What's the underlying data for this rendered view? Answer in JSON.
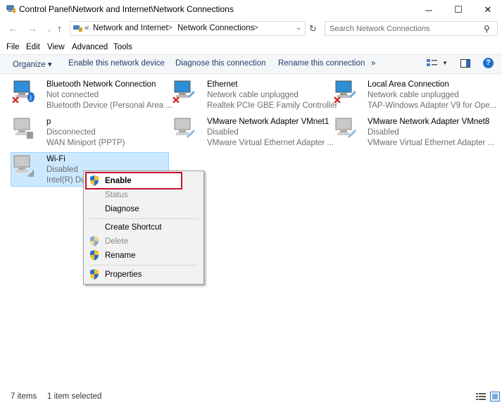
{
  "window": {
    "title": "Control Panel\\Network and Internet\\Network Connections"
  },
  "nav": {
    "breadcrumb_prefix": "«",
    "breadcrumb": [
      "Network and Internet",
      "Network Connections"
    ],
    "separator": ">",
    "search_placeholder": "Search Network Connections"
  },
  "menubar": [
    "File",
    "Edit",
    "View",
    "Advanced",
    "Tools"
  ],
  "commandbar": {
    "organize": "Organize ▾",
    "enable": "Enable this network device",
    "diagnose": "Diagnose this connection",
    "rename": "Rename this connection",
    "more": "»",
    "help": "?"
  },
  "items": [
    {
      "name": "Bluetooth Network Connection",
      "status": "Not connected",
      "device": "Bluetooth Device (Personal Area ...",
      "icon": "bluetooth-network-icon"
    },
    {
      "name": "Ethernet",
      "status": "Network cable unplugged",
      "device": "Realtek PCIe GBE Family Controller",
      "icon": "ethernet-icon"
    },
    {
      "name": "Local Area Connection",
      "status": "Network cable unplugged",
      "device": "TAP-Windows Adapter V9 for Ope...",
      "icon": "lan-icon"
    },
    {
      "name": "p",
      "status": "Disconnected",
      "device": "WAN Miniport (PPTP)",
      "icon": "vpn-icon"
    },
    {
      "name": "VMware Network Adapter VMnet1",
      "status": "Disabled",
      "device": "VMware Virtual Ethernet Adapter ...",
      "icon": "vmware-adapter-icon"
    },
    {
      "name": "VMware Network Adapter VMnet8",
      "status": "Disabled",
      "device": "VMware Virtual Ethernet Adapter ...",
      "icon": "vmware-adapter-icon"
    },
    {
      "name": "Wi-Fi",
      "status": "Disabled",
      "device": "Intel(R) Du",
      "icon": "wifi-icon"
    }
  ],
  "context_menu": {
    "enable": "Enable",
    "status": "Status",
    "diagnose": "Diagnose",
    "create_shortcut": "Create Shortcut",
    "delete": "Delete",
    "rename": "Rename",
    "properties": "Properties"
  },
  "statusbar": {
    "count": "7 items",
    "selected": "1 item selected"
  },
  "colors": {
    "accent": "#1f6fd0",
    "selection": "#cce8ff",
    "highlight_box": "#c8102e"
  }
}
